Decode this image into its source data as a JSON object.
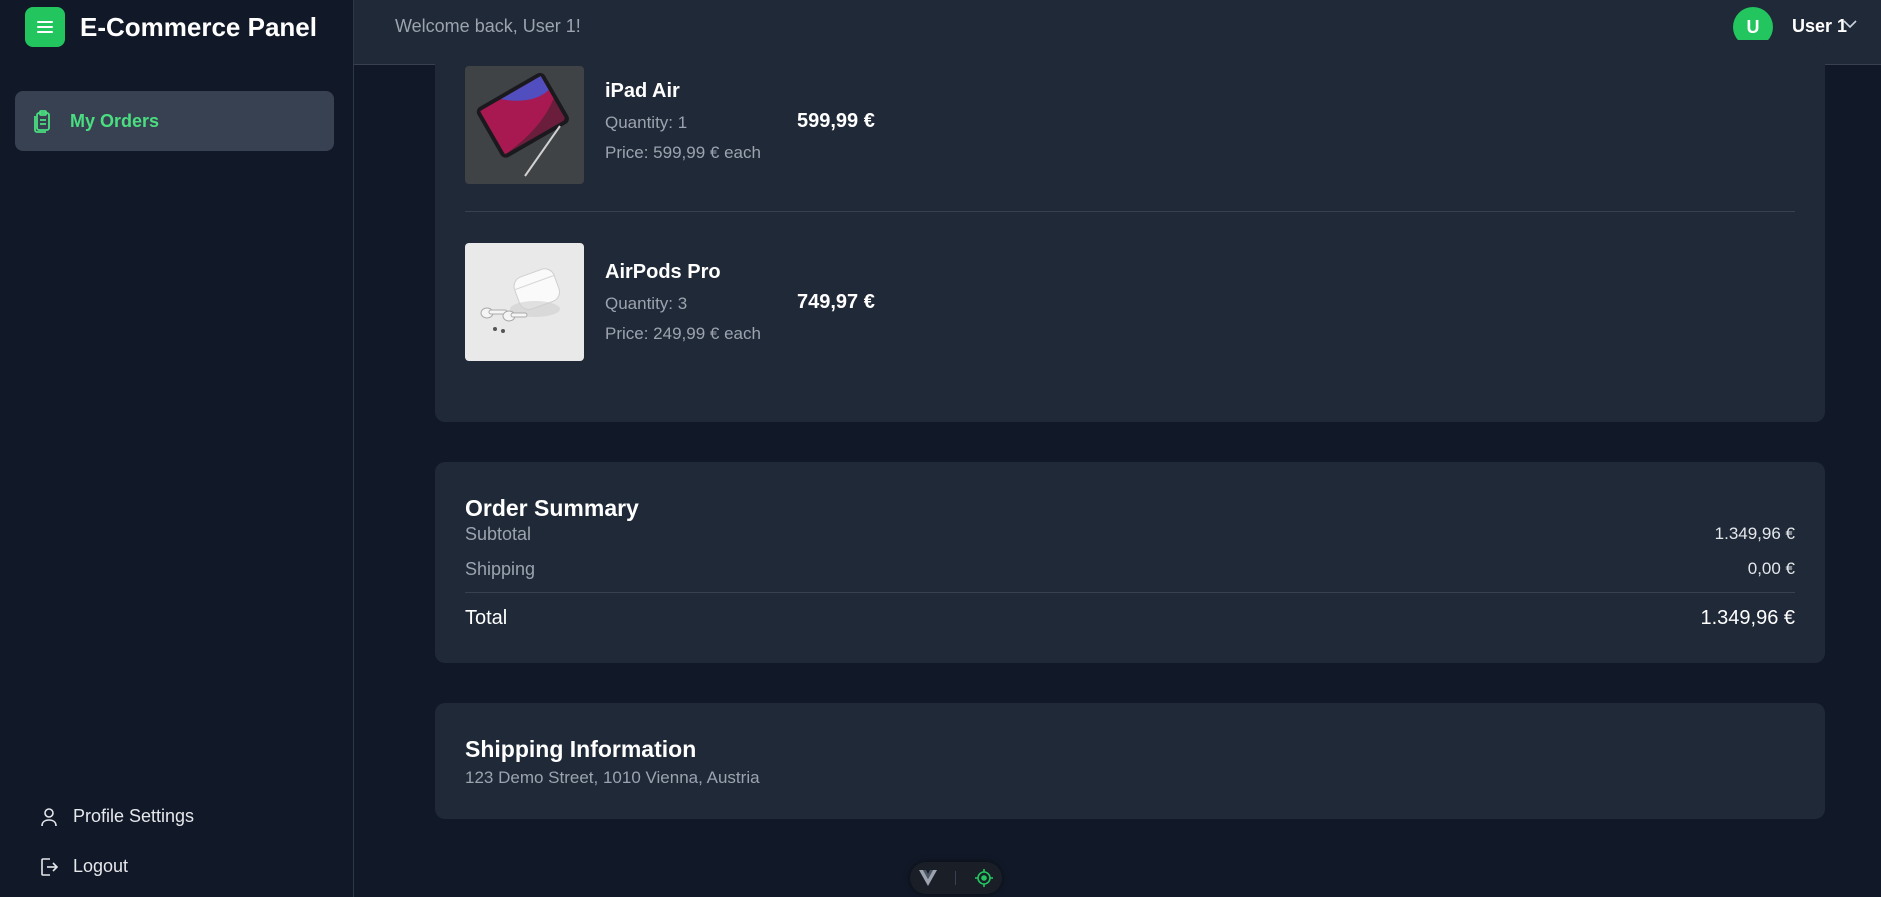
{
  "app": {
    "title": "E-Commerce Panel",
    "accent_color": "#22c55e",
    "menu_icon": "hamburger-icon"
  },
  "sidebar": {
    "items": [
      {
        "label": "My Orders",
        "icon": "clipboard-icon",
        "active": true
      }
    ],
    "bottom_items": [
      {
        "label": "Profile Settings",
        "icon": "user-icon"
      },
      {
        "label": "Logout",
        "icon": "logout-icon"
      }
    ]
  },
  "header": {
    "welcome": "Welcome back, User 1!",
    "avatar_initial": "U",
    "user_name": "User 1",
    "chevron_icon": "chevron-down-icon"
  },
  "order_items": [
    {
      "name": "iPad Air",
      "quantity": "Quantity: 1",
      "unit_price": "Price: 599,99 € each",
      "total": "599,99 €",
      "thumbnail": "ipad-image"
    },
    {
      "name": "AirPods Pro",
      "quantity": "Quantity: 3",
      "unit_price": "Price: 249,99 € each",
      "total": "749,97 €",
      "thumbnail": "airpods-image"
    }
  ],
  "order_summary": {
    "title": "Order Summary",
    "subtotal_label": "Subtotal",
    "subtotal_value": "1.349,96 €",
    "shipping_label": "Shipping",
    "shipping_value": "0,00 €",
    "total_label": "Total",
    "total_value": "1.349,96 €"
  },
  "shipping_info": {
    "title": "Shipping Information",
    "address": "123 Demo Street, 1010 Vienna, Austria"
  },
  "dev_toolbar": {
    "icons": [
      "vue-logo-icon",
      "target-icon"
    ]
  }
}
